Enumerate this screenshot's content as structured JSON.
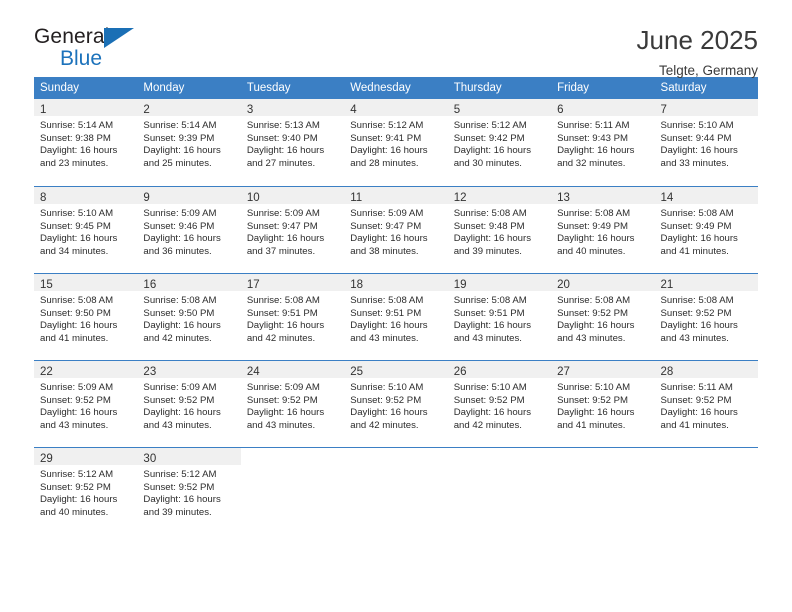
{
  "brand": {
    "name_top": "General",
    "name_bottom": "Blue",
    "accent_color": "#1a6fb5"
  },
  "header": {
    "title": "June 2025",
    "subtitle": "Telgte, Germany"
  },
  "theme": {
    "header_blue": "#3b7fc4",
    "daynum_band": "#f0f0f0",
    "text": "#2c2c2c"
  },
  "calendar": {
    "weekdays": [
      "Sunday",
      "Monday",
      "Tuesday",
      "Wednesday",
      "Thursday",
      "Friday",
      "Saturday"
    ],
    "weeks": [
      [
        {
          "day": "1",
          "lines": [
            "Sunrise: 5:14 AM",
            "Sunset: 9:38 PM",
            "Daylight: 16 hours",
            "and 23 minutes."
          ]
        },
        {
          "day": "2",
          "lines": [
            "Sunrise: 5:14 AM",
            "Sunset: 9:39 PM",
            "Daylight: 16 hours",
            "and 25 minutes."
          ]
        },
        {
          "day": "3",
          "lines": [
            "Sunrise: 5:13 AM",
            "Sunset: 9:40 PM",
            "Daylight: 16 hours",
            "and 27 minutes."
          ]
        },
        {
          "day": "4",
          "lines": [
            "Sunrise: 5:12 AM",
            "Sunset: 9:41 PM",
            "Daylight: 16 hours",
            "and 28 minutes."
          ]
        },
        {
          "day": "5",
          "lines": [
            "Sunrise: 5:12 AM",
            "Sunset: 9:42 PM",
            "Daylight: 16 hours",
            "and 30 minutes."
          ]
        },
        {
          "day": "6",
          "lines": [
            "Sunrise: 5:11 AM",
            "Sunset: 9:43 PM",
            "Daylight: 16 hours",
            "and 32 minutes."
          ]
        },
        {
          "day": "7",
          "lines": [
            "Sunrise: 5:10 AM",
            "Sunset: 9:44 PM",
            "Daylight: 16 hours",
            "and 33 minutes."
          ]
        }
      ],
      [
        {
          "day": "8",
          "lines": [
            "Sunrise: 5:10 AM",
            "Sunset: 9:45 PM",
            "Daylight: 16 hours",
            "and 34 minutes."
          ]
        },
        {
          "day": "9",
          "lines": [
            "Sunrise: 5:09 AM",
            "Sunset: 9:46 PM",
            "Daylight: 16 hours",
            "and 36 minutes."
          ]
        },
        {
          "day": "10",
          "lines": [
            "Sunrise: 5:09 AM",
            "Sunset: 9:47 PM",
            "Daylight: 16 hours",
            "and 37 minutes."
          ]
        },
        {
          "day": "11",
          "lines": [
            "Sunrise: 5:09 AM",
            "Sunset: 9:47 PM",
            "Daylight: 16 hours",
            "and 38 minutes."
          ]
        },
        {
          "day": "12",
          "lines": [
            "Sunrise: 5:08 AM",
            "Sunset: 9:48 PM",
            "Daylight: 16 hours",
            "and 39 minutes."
          ]
        },
        {
          "day": "13",
          "lines": [
            "Sunrise: 5:08 AM",
            "Sunset: 9:49 PM",
            "Daylight: 16 hours",
            "and 40 minutes."
          ]
        },
        {
          "day": "14",
          "lines": [
            "Sunrise: 5:08 AM",
            "Sunset: 9:49 PM",
            "Daylight: 16 hours",
            "and 41 minutes."
          ]
        }
      ],
      [
        {
          "day": "15",
          "lines": [
            "Sunrise: 5:08 AM",
            "Sunset: 9:50 PM",
            "Daylight: 16 hours",
            "and 41 minutes."
          ]
        },
        {
          "day": "16",
          "lines": [
            "Sunrise: 5:08 AM",
            "Sunset: 9:50 PM",
            "Daylight: 16 hours",
            "and 42 minutes."
          ]
        },
        {
          "day": "17",
          "lines": [
            "Sunrise: 5:08 AM",
            "Sunset: 9:51 PM",
            "Daylight: 16 hours",
            "and 42 minutes."
          ]
        },
        {
          "day": "18",
          "lines": [
            "Sunrise: 5:08 AM",
            "Sunset: 9:51 PM",
            "Daylight: 16 hours",
            "and 43 minutes."
          ]
        },
        {
          "day": "19",
          "lines": [
            "Sunrise: 5:08 AM",
            "Sunset: 9:51 PM",
            "Daylight: 16 hours",
            "and 43 minutes."
          ]
        },
        {
          "day": "20",
          "lines": [
            "Sunrise: 5:08 AM",
            "Sunset: 9:52 PM",
            "Daylight: 16 hours",
            "and 43 minutes."
          ]
        },
        {
          "day": "21",
          "lines": [
            "Sunrise: 5:08 AM",
            "Sunset: 9:52 PM",
            "Daylight: 16 hours",
            "and 43 minutes."
          ]
        }
      ],
      [
        {
          "day": "22",
          "lines": [
            "Sunrise: 5:09 AM",
            "Sunset: 9:52 PM",
            "Daylight: 16 hours",
            "and 43 minutes."
          ]
        },
        {
          "day": "23",
          "lines": [
            "Sunrise: 5:09 AM",
            "Sunset: 9:52 PM",
            "Daylight: 16 hours",
            "and 43 minutes."
          ]
        },
        {
          "day": "24",
          "lines": [
            "Sunrise: 5:09 AM",
            "Sunset: 9:52 PM",
            "Daylight: 16 hours",
            "and 43 minutes."
          ]
        },
        {
          "day": "25",
          "lines": [
            "Sunrise: 5:10 AM",
            "Sunset: 9:52 PM",
            "Daylight: 16 hours",
            "and 42 minutes."
          ]
        },
        {
          "day": "26",
          "lines": [
            "Sunrise: 5:10 AM",
            "Sunset: 9:52 PM",
            "Daylight: 16 hours",
            "and 42 minutes."
          ]
        },
        {
          "day": "27",
          "lines": [
            "Sunrise: 5:10 AM",
            "Sunset: 9:52 PM",
            "Daylight: 16 hours",
            "and 41 minutes."
          ]
        },
        {
          "day": "28",
          "lines": [
            "Sunrise: 5:11 AM",
            "Sunset: 9:52 PM",
            "Daylight: 16 hours",
            "and 41 minutes."
          ]
        }
      ],
      [
        {
          "day": "29",
          "lines": [
            "Sunrise: 5:12 AM",
            "Sunset: 9:52 PM",
            "Daylight: 16 hours",
            "and 40 minutes."
          ]
        },
        {
          "day": "30",
          "lines": [
            "Sunrise: 5:12 AM",
            "Sunset: 9:52 PM",
            "Daylight: 16 hours",
            "and 39 minutes."
          ]
        },
        {
          "day": "",
          "lines": []
        },
        {
          "day": "",
          "lines": []
        },
        {
          "day": "",
          "lines": []
        },
        {
          "day": "",
          "lines": []
        },
        {
          "day": "",
          "lines": []
        }
      ]
    ]
  }
}
